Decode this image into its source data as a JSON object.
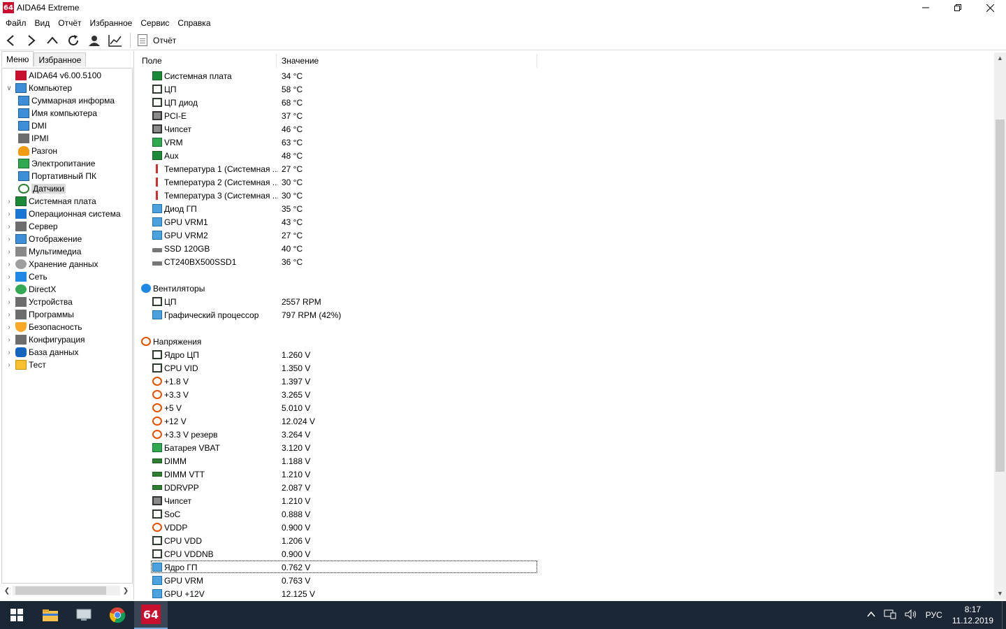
{
  "window": {
    "title": "AIDA64 Extreme",
    "app_icon_text": "64",
    "controls": [
      "–",
      "❐",
      "✕"
    ]
  },
  "menubar": [
    "Файл",
    "Вид",
    "Отчёт",
    "Избранное",
    "Сервис",
    "Справка"
  ],
  "toolbar": {
    "report_label": "Отчёт"
  },
  "left_tabs": [
    "Меню",
    "Избранное"
  ],
  "tree": [
    {
      "label": "AIDA64 v6.00.5100",
      "level": 0,
      "exp": "",
      "icon": "aida"
    },
    {
      "label": "Компьютер",
      "level": 0,
      "exp": "∨",
      "icon": "monitor"
    },
    {
      "label": "Суммарная информа",
      "level": 1,
      "exp": "",
      "icon": "monitor"
    },
    {
      "label": "Имя компьютера",
      "level": 1,
      "exp": "",
      "icon": "monitor"
    },
    {
      "label": "DMI",
      "level": 1,
      "exp": "",
      "icon": "monitor"
    },
    {
      "label": "IPMI",
      "level": 1,
      "exp": "",
      "icon": "gray"
    },
    {
      "label": "Разгон",
      "level": 1,
      "exp": "",
      "icon": "fire"
    },
    {
      "label": "Электропитание",
      "level": 1,
      "exp": "",
      "icon": "bat"
    },
    {
      "label": "Портативный ПК",
      "level": 1,
      "exp": "",
      "icon": "monitor"
    },
    {
      "label": "Датчики",
      "level": 1,
      "exp": "",
      "icon": "gauge",
      "selected": true
    },
    {
      "label": "Системная плата",
      "level": 0,
      "exp": "›",
      "icon": "board"
    },
    {
      "label": "Операционная система",
      "level": 0,
      "exp": "›",
      "icon": "win"
    },
    {
      "label": "Сервер",
      "level": 0,
      "exp": "›",
      "icon": "gray"
    },
    {
      "label": "Отображение",
      "level": 0,
      "exp": "›",
      "icon": "monitor"
    },
    {
      "label": "Мультимедиа",
      "level": 0,
      "exp": "›",
      "icon": "speaker"
    },
    {
      "label": "Хранение данных",
      "level": 0,
      "exp": "›",
      "icon": "disk"
    },
    {
      "label": "Сеть",
      "level": 0,
      "exp": "›",
      "icon": "net"
    },
    {
      "label": "DirectX",
      "level": 0,
      "exp": "›",
      "icon": "green"
    },
    {
      "label": "Устройства",
      "level": 0,
      "exp": "›",
      "icon": "gray"
    },
    {
      "label": "Программы",
      "level": 0,
      "exp": "›",
      "icon": "gray"
    },
    {
      "label": "Безопасность",
      "level": 0,
      "exp": "›",
      "icon": "shield"
    },
    {
      "label": "Конфигурация",
      "level": 0,
      "exp": "›",
      "icon": "gray"
    },
    {
      "label": "База данных",
      "level": 0,
      "exp": "›",
      "icon": "db"
    },
    {
      "label": "Тест",
      "level": 0,
      "exp": "›",
      "icon": "test"
    }
  ],
  "columns": [
    "Поле",
    "Значение"
  ],
  "rows": [
    {
      "field": "Системная плата",
      "value": "34 °C",
      "icon": "board"
    },
    {
      "field": "ЦП",
      "value": "58 °C",
      "icon": "chip"
    },
    {
      "field": "ЦП диод",
      "value": "68 °C",
      "icon": "chip"
    },
    {
      "field": "PCI-E",
      "value": "37 °C",
      "icon": "chip2"
    },
    {
      "field": "Чипсет",
      "value": "46 °C",
      "icon": "chip2"
    },
    {
      "field": "VRM",
      "value": "63 °C",
      "icon": "bat"
    },
    {
      "field": "Aux",
      "value": "48 °C",
      "icon": "board"
    },
    {
      "field": "Температура 1 (Системная ...",
      "value": "27 °C",
      "icon": "therm"
    },
    {
      "field": "Температура 2 (Системная ...",
      "value": "30 °C",
      "icon": "therm"
    },
    {
      "field": "Температура 3 (Системная ...",
      "value": "30 °C",
      "icon": "therm"
    },
    {
      "field": "Диод ГП",
      "value": "35 °C",
      "icon": "gpu"
    },
    {
      "field": "GPU VRM1",
      "value": "43 °C",
      "icon": "gpu"
    },
    {
      "field": "GPU VRM2",
      "value": "27 °C",
      "icon": "gpu"
    },
    {
      "field": "SSD 120GB",
      "value": "40 °C",
      "icon": "ssd"
    },
    {
      "field": "CT240BX500SSD1",
      "value": "36 °C",
      "icon": "ssd"
    },
    {
      "field": "",
      "value": "",
      "icon": "",
      "blank": true
    },
    {
      "field": "Вентиляторы",
      "value": "",
      "icon": "fan",
      "section": true
    },
    {
      "field": "ЦП",
      "value": "2557 RPM",
      "icon": "chip"
    },
    {
      "field": "Графический процессор",
      "value": "797 RPM  (42%)",
      "icon": "gpu"
    },
    {
      "field": "",
      "value": "",
      "icon": "",
      "blank": true
    },
    {
      "field": "Напряжения",
      "value": "",
      "icon": "volt",
      "section": true
    },
    {
      "field": "Ядро ЦП",
      "value": "1.260 V",
      "icon": "chip"
    },
    {
      "field": "CPU VID",
      "value": "1.350 V",
      "icon": "chip"
    },
    {
      "field": "+1.8 V",
      "value": "1.397 V",
      "icon": "volt"
    },
    {
      "field": "+3.3 V",
      "value": "3.265 V",
      "icon": "volt"
    },
    {
      "field": "+5 V",
      "value": "5.010 V",
      "icon": "volt"
    },
    {
      "field": "+12 V",
      "value": "12.024 V",
      "icon": "volt"
    },
    {
      "field": "+3.3 V резерв",
      "value": "3.264 V",
      "icon": "volt"
    },
    {
      "field": "Батарея VBAT",
      "value": "3.120 V",
      "icon": "bat"
    },
    {
      "field": "DIMM",
      "value": "1.188 V",
      "icon": "dimm"
    },
    {
      "field": "DIMM VTT",
      "value": "1.210 V",
      "icon": "dimm"
    },
    {
      "field": "DDRVPP",
      "value": "2.087 V",
      "icon": "dimm"
    },
    {
      "field": "Чипсет",
      "value": "1.210 V",
      "icon": "chip2"
    },
    {
      "field": "SoC",
      "value": "0.888 V",
      "icon": "chip"
    },
    {
      "field": "VDDP",
      "value": "0.900 V",
      "icon": "volt"
    },
    {
      "field": "CPU VDD",
      "value": "1.206 V",
      "icon": "chip"
    },
    {
      "field": "CPU VDDNB",
      "value": "0.900 V",
      "icon": "chip"
    },
    {
      "field": "Ядро ГП",
      "value": "0.762 V",
      "icon": "gpu",
      "focused": true
    },
    {
      "field": "GPU VRM",
      "value": "0.763 V",
      "icon": "gpu"
    },
    {
      "field": "GPU +12V",
      "value": "12.125 V",
      "icon": "gpu"
    }
  ],
  "taskbar": {
    "aida_label": "64",
    "language": "РУС",
    "time": "8:17",
    "date": "11.12.2019"
  }
}
